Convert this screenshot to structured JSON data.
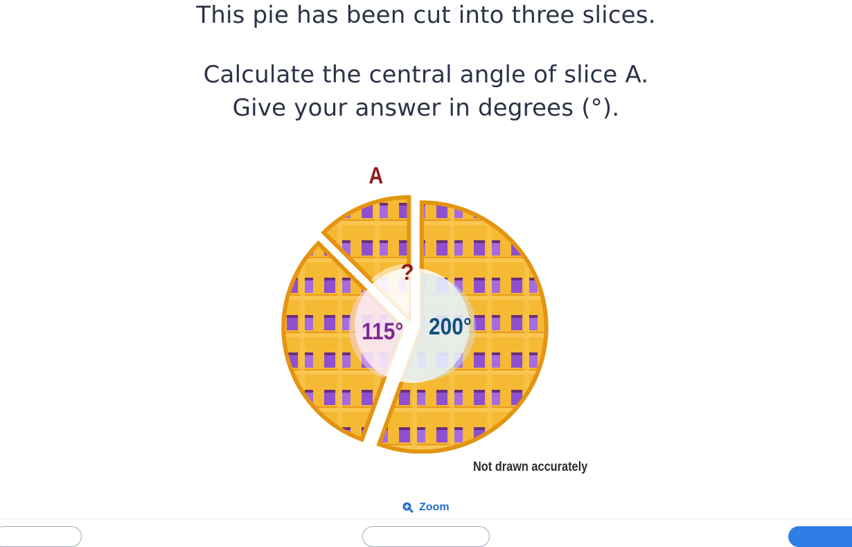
{
  "question": {
    "line1": "This pie has been cut into three slices.",
    "line2": "Calculate the central angle of slice A.",
    "line3": "Give your answer in degrees (°)."
  },
  "diagram": {
    "slice_label": "A",
    "unknown_label": "?",
    "angle_left": "115°",
    "angle_right": "200°",
    "disclaimer": "Not drawn accurately",
    "colors": {
      "crust": "#f5b52a",
      "crust_dark": "#e39412",
      "filling": "#9a55d6",
      "slice_label": "#8c1c1c",
      "angle_left": "#7b2a8f",
      "angle_right": "#114f7a"
    }
  },
  "zoom": {
    "label": "Zoom",
    "icon": "zoom-in-icon"
  }
}
